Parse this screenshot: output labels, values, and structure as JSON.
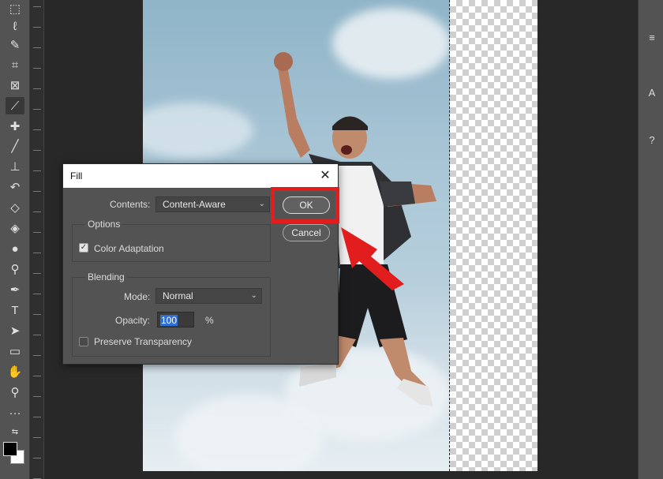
{
  "dialog": {
    "title": "Fill",
    "contents_label": "Contents:",
    "contents_value": "Content-Aware",
    "options_title": "Options",
    "color_adaptation_label": "Color Adaptation",
    "color_adaptation_checked": true,
    "blending_title": "Blending",
    "mode_label": "Mode:",
    "mode_value": "Normal",
    "opacity_label": "Opacity:",
    "opacity_value": "100",
    "opacity_unit": "%",
    "preserve_label": "Preserve Transparency",
    "preserve_checked": false,
    "ok_label": "OK",
    "cancel_label": "Cancel"
  },
  "annotation": {
    "color": "#e11d1d"
  },
  "toolbar": {
    "icons": [
      "marquee-icon",
      "lasso-icon",
      "quick-select-icon",
      "crop-icon",
      "frame-icon",
      "eyedropper-icon",
      "healing-brush-icon",
      "brush-icon",
      "clone-stamp-icon",
      "history-brush-icon",
      "eraser-icon",
      "paint-bucket-icon",
      "blur-icon",
      "dodge-icon",
      "pen-icon",
      "type-icon",
      "path-select-icon",
      "shape-icon",
      "hand-icon",
      "zoom-icon",
      "more-icon"
    ]
  }
}
